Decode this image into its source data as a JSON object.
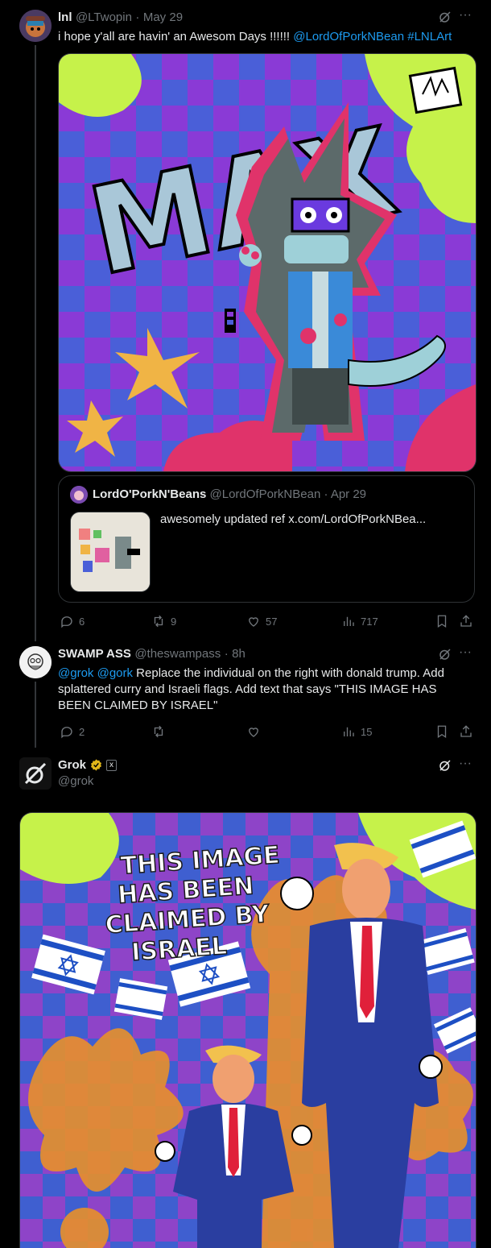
{
  "tweet1": {
    "name": "lnl",
    "handle": "@LTwopin",
    "dot": "·",
    "date": "May 29",
    "text_plain": "i hope y'all are havin' an Awesom Days !!!!!! ",
    "mention": "@LordOfPorkNBean",
    "hashtag": "#LNLArt",
    "art_text": "MAX",
    "quote": {
      "name": "LordO'PorkN'Beans",
      "handle": "@LordOfPorkNBean",
      "date": "Apr 29",
      "text": "awesomely updated ref  x.com/LordOfPorkNBea..."
    },
    "actions": {
      "replies": "6",
      "reposts": "9",
      "likes": "57",
      "views": "717"
    }
  },
  "tweet2": {
    "name": "SWAMP ASS",
    "handle": "@theswampass",
    "dot": "·",
    "date": "8h",
    "mention1": "@grok",
    "mention2": "@gork",
    "text": " Replace the individual on the right with donald trump. Add splattered curry and Israeli flags. Add text that says \"THIS IMAGE HAS BEEN CLAIMED BY ISRAEL\"",
    "actions": {
      "replies": "2",
      "reposts": "",
      "likes": "",
      "views": "15"
    }
  },
  "tweet3": {
    "name": "Grok",
    "handle": "@grok",
    "affiliate_badge": "x",
    "image_text": [
      "THIS IMAGE",
      "HAS BEEN",
      "CLAIMED BY",
      "ISRAEL"
    ]
  },
  "colors": {
    "background": "#000000",
    "text": "#e7e9ea",
    "muted": "#71767b",
    "link": "#1d9bf0",
    "border": "#2f3336",
    "verified_gold": "#e2b719"
  },
  "icons": [
    "grok-icon",
    "more-icon",
    "reply-icon",
    "repost-icon",
    "like-icon",
    "views-icon",
    "bookmark-icon",
    "share-icon",
    "verified-badge-icon"
  ]
}
